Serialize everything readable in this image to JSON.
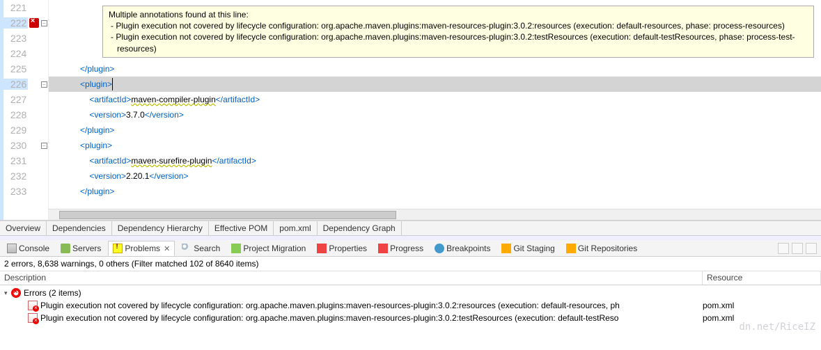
{
  "tooltip": {
    "title": "Multiple annotations found at this line:",
    "items": [
      "- Plugin execution not covered by lifecycle configuration: org.apache.maven.plugins:maven-resources-plugin:3.0.2:resources (execution: default-resources, phase: process-resources)",
      "- Plugin execution not covered by lifecycle configuration: org.apache.maven.plugins:maven-resources-plugin:3.0.2:testResources (execution: default-testResources, phase: process-test-resources)"
    ]
  },
  "lines": {
    "221": "",
    "222": "",
    "223": "",
    "224": "",
    "225": "",
    "226": "",
    "227": "",
    "228": "",
    "229": "",
    "230": "",
    "231": "",
    "232": "",
    "233": ""
  },
  "code": {
    "l225": {
      "indent": "            ",
      "tag_close_plugin": "</plugin>"
    },
    "l226": {
      "indent": "            ",
      "tag_open_plugin": "<plugin>"
    },
    "l227": {
      "indent": "                ",
      "tag_o": "<artifactId>",
      "val": "maven-compiler-plugin",
      "tag_c": "</artifactId>"
    },
    "l228": {
      "indent": "                ",
      "tag_o": "<version>",
      "val": "3.7.0",
      "tag_c": "</version>"
    },
    "l229": {
      "indent": "            ",
      "tag_close_plugin": "</plugin>"
    },
    "l230": {
      "indent": "            ",
      "tag_open_plugin": "<plugin>"
    },
    "l231": {
      "indent": "                ",
      "tag_o": "<artifactId>",
      "val": "maven-surefire-plugin",
      "tag_c": "</artifactId>"
    },
    "l232": {
      "indent": "                ",
      "tag_o": "<version>",
      "val": "2.20.1",
      "tag_c": "</version>"
    },
    "l233": {
      "indent": "            ",
      "tag_close_plugin": "</plugin>"
    }
  },
  "editor_tabs": {
    "overview": "Overview",
    "dependencies": "Dependencies",
    "dep_hierarchy": "Dependency Hierarchy",
    "effective_pom": "Effective POM",
    "pom_xml": "pom.xml",
    "dep_graph": "Dependency Graph"
  },
  "view_tabs": {
    "console": "Console",
    "servers": "Servers",
    "problems": "Problems",
    "search": "Search",
    "migration": "Project Migration",
    "properties": "Properties",
    "progress": "Progress",
    "breakpoints": "Breakpoints",
    "git_staging": "Git Staging",
    "git_repos": "Git Repositories"
  },
  "problems": {
    "filter": "2 errors, 8,638 warnings, 0 others (Filter matched 102 of 8640 items)",
    "headers": {
      "description": "Description",
      "resource": "Resource"
    },
    "group": "Errors (2 items)",
    "items": [
      {
        "text": "Plugin execution not covered by lifecycle configuration: org.apache.maven.plugins:maven-resources-plugin:3.0.2:resources (execution: default-resources, ph",
        "resource": "pom.xml"
      },
      {
        "text": "Plugin execution not covered by lifecycle configuration: org.apache.maven.plugins:maven-resources-plugin:3.0.2:testResources (execution: default-testReso",
        "resource": "pom.xml"
      }
    ]
  },
  "watermark": "dn.net/RiceIZ"
}
